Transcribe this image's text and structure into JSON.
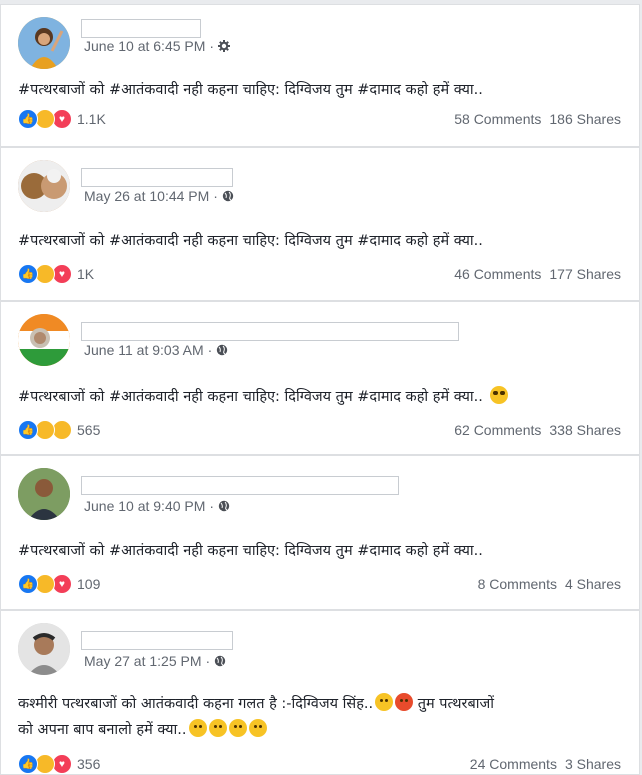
{
  "posts": [
    {
      "date": "June 10 at 6:45 PM",
      "privacy_icon": "gear-icon",
      "text": "#पत्थरबाजों को #आतंकवादी नही कहना चाहिए: दिग्विजय तुम #दामाद कहो हमें क्या..",
      "text_emojis": [],
      "reactions": [
        "like",
        "haha",
        "love"
      ],
      "reaction_count": "1.1K",
      "comments": "58 Comments",
      "shares": "186 Shares"
    },
    {
      "date": "May 26 at 10:44 PM",
      "privacy_icon": "globe-icon",
      "text": "#पत्थरबाजों को #आतंकवादी नही कहना चाहिए: दिग्विजय तुम #दामाद कहो हमें क्या..",
      "text_emojis": [],
      "reactions": [
        "like",
        "haha",
        "love"
      ],
      "reaction_count": "1K",
      "comments": "46 Comments",
      "shares": "177 Shares"
    },
    {
      "date": "June 11 at 9:03 AM",
      "privacy_icon": "globe-icon",
      "text": "#पत्थरबाजों को #आतंकवादी नही कहना चाहिए: दिग्विजय तुम #दामाद कहो हमें क्या..",
      "text_emojis": [
        "sunglasses-emoji"
      ],
      "reactions": [
        "like",
        "haha",
        "wow"
      ],
      "reaction_count": "565",
      "comments": "62 Comments",
      "shares": "338 Shares"
    },
    {
      "date": "June 10 at 9:40 PM",
      "privacy_icon": "globe-icon",
      "text": "#पत्थरबाजों को #आतंकवादी नही कहना चाहिए: दिग्विजय तुम #दामाद कहो हमें क्या..",
      "text_emojis": [],
      "reactions": [
        "like",
        "haha",
        "love"
      ],
      "reaction_count": "109",
      "comments": "8 Comments",
      "shares": "4 Shares"
    },
    {
      "date": "May 27 at 1:25 PM",
      "privacy_icon": "globe-icon",
      "text_line1": "कश्मीरी पत्थरबाजों को आतंकवादी कहना गलत है :-दिग्विजय सिंह..",
      "text_line1_after": " तुम पत्थरबाजों",
      "text_line2": "को अपना बाप बनालो हमें क्या..",
      "reactions": [
        "like",
        "haha",
        "love"
      ],
      "reaction_count": "356",
      "comments": "24 Comments",
      "shares": "3 Shares"
    }
  ],
  "colors": {
    "like": "#1877f2",
    "haha": "#f7b928",
    "love": "#f33e58",
    "meta_text": "#616770"
  }
}
